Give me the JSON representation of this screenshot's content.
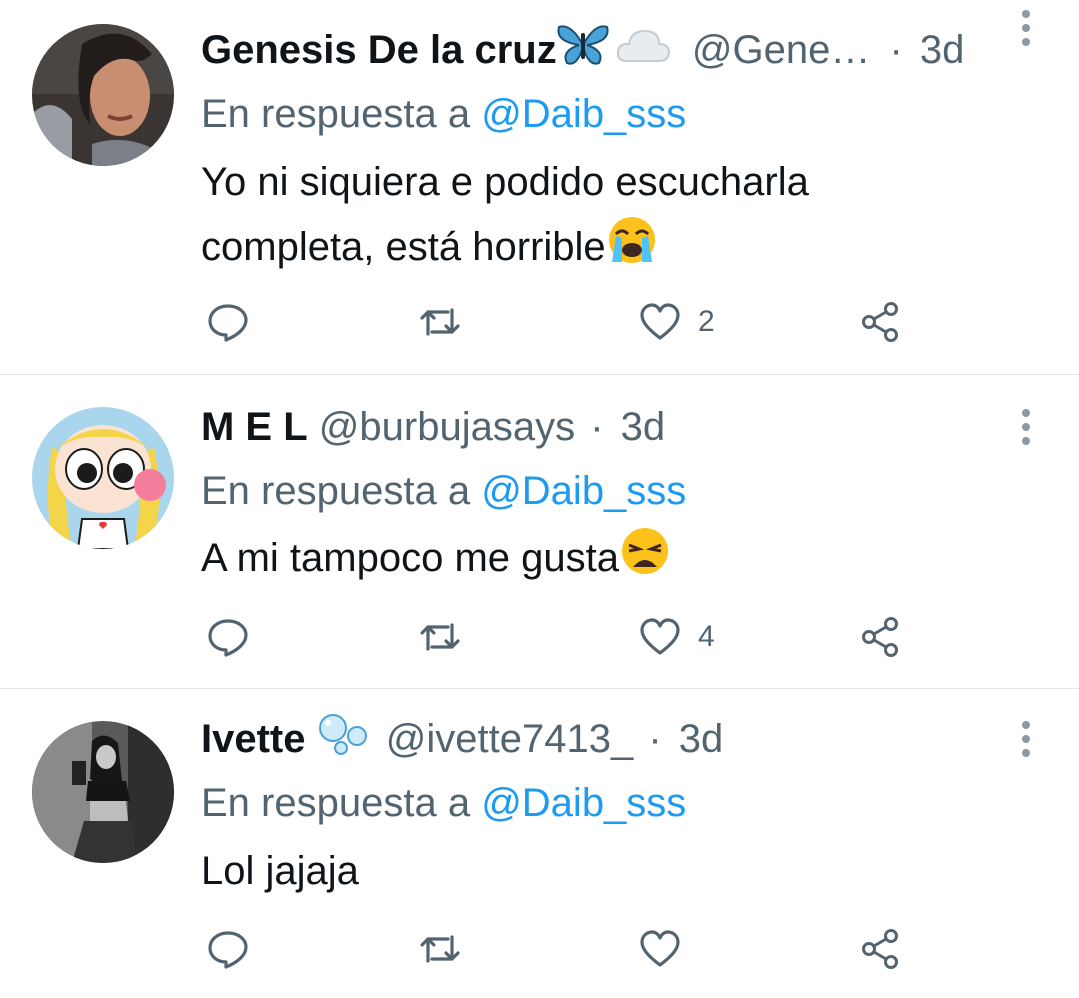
{
  "tweets": [
    {
      "name": "Genesis De la cruz",
      "name_emojis": [
        "butterfly-emoji",
        "cloud-emoji"
      ],
      "handle": "@Gene…",
      "separator": "·",
      "time": "3d",
      "reply_prefix": "En respuesta a",
      "reply_to": "@Daib_sss",
      "text_line1": "Yo ni siquiera e podido escucharla",
      "text_line2": "completa, está horrible",
      "text_emoji": "loudly-crying-face-emoji",
      "like_count": "2"
    },
    {
      "name": "M E L",
      "handle": "@burbujasays",
      "separator": "·",
      "time": "3d",
      "reply_prefix": "En respuesta a",
      "reply_to": "@Daib_sss",
      "text_line1": "A mi tampoco me gusta",
      "text_emoji": "weary-face-emoji",
      "like_count": "4"
    },
    {
      "name": "Ivette",
      "name_emojis": [
        "bubbles-emoji"
      ],
      "handle": "@ivette7413_",
      "separator": "·",
      "time": "3d",
      "reply_prefix": "En respuesta a",
      "reply_to": "@Daib_sss",
      "text_line1": "Lol jajaja",
      "like_count": ""
    }
  ],
  "icons": {
    "reply": "reply-icon",
    "retweet": "retweet-icon",
    "like": "heart-icon",
    "share": "share-icon",
    "more": "more-options-icon"
  },
  "colors": {
    "primary_text": "#0f1419",
    "secondary_text": "#536471",
    "mention": "#1d9bf0",
    "divider": "#e1e5e8"
  }
}
